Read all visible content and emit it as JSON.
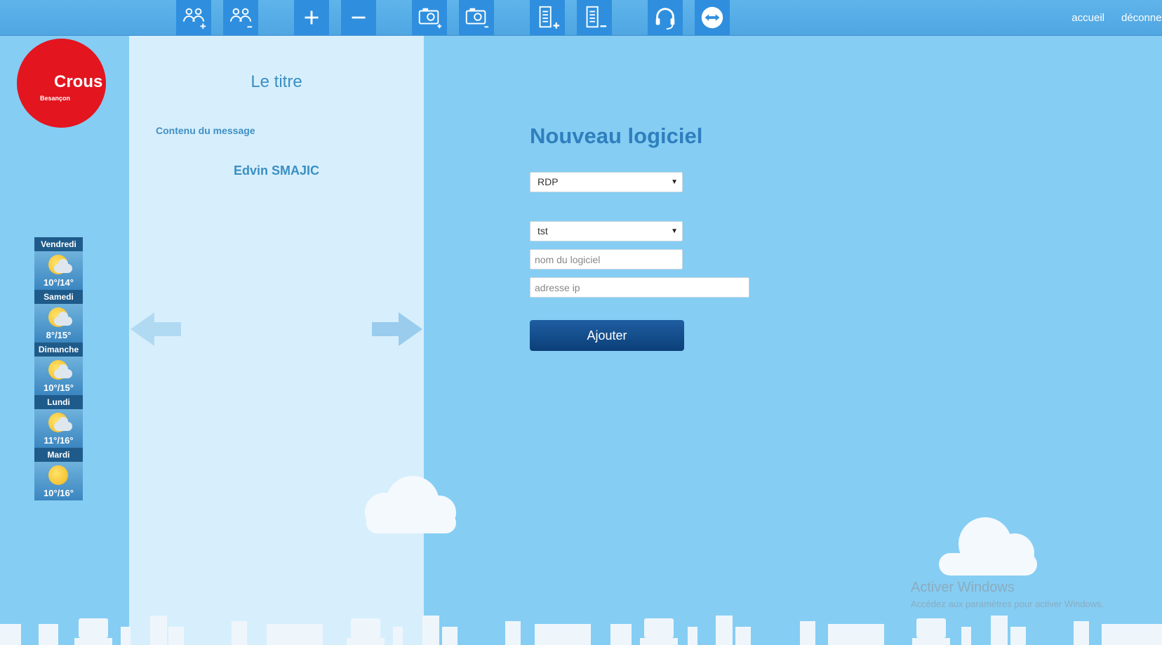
{
  "toolbar": {
    "buttons": [
      {
        "name": "add-group-icon"
      },
      {
        "name": "remove-group-icon"
      },
      {
        "name": "plus-icon"
      },
      {
        "name": "minus-icon"
      },
      {
        "name": "camera-add-icon"
      },
      {
        "name": "camera-remove-icon"
      },
      {
        "name": "list-add-icon"
      },
      {
        "name": "list-remove-icon"
      },
      {
        "name": "headset-icon"
      },
      {
        "name": "teamviewer-icon"
      }
    ],
    "nav": {
      "home": "accueil",
      "logout": "déconnexion"
    },
    "colors": {
      "button_bg": "#2f8fde",
      "bar_bg": "#4fa6e2"
    }
  },
  "logo": {
    "name": "Crous",
    "city": "Besançon",
    "color": "#e3151f"
  },
  "message": {
    "title": "Le titre",
    "body": "Contenu du message",
    "author": "Edvin SMAJIC"
  },
  "weather": [
    {
      "day": "Vendredi",
      "temp": "10°/14°",
      "icon": "partly-cloudy-icon"
    },
    {
      "day": "Samedi",
      "temp": "8°/15°",
      "icon": "partly-cloudy-icon"
    },
    {
      "day": "Dimanche",
      "temp": "10°/15°",
      "icon": "partly-cloudy-icon"
    },
    {
      "day": "Lundi",
      "temp": "11°/16°",
      "icon": "partly-cloudy-icon"
    },
    {
      "day": "Mardi",
      "temp": "10°/16°",
      "icon": "sunny-icon"
    }
  ],
  "form": {
    "title": "Nouveau logiciel",
    "protocol_selected": "RDP",
    "group_selected": "tst",
    "name_placeholder": "nom du logiciel",
    "ip_placeholder": "adresse ip",
    "submit_label": "Ajouter"
  },
  "watermark": {
    "line1": "Activer Windows",
    "line2": "Accédez aux paramètres pour activer Windows."
  }
}
